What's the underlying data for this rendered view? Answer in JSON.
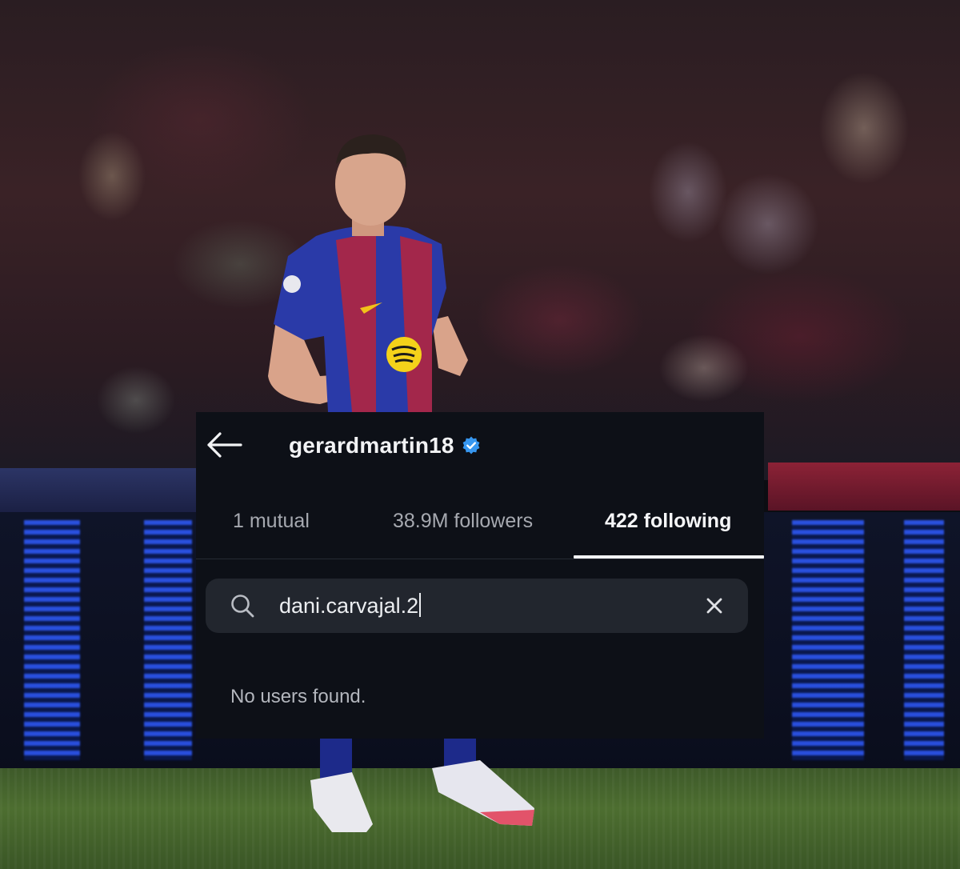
{
  "profile": {
    "username": "gerardmartin18",
    "verified": true
  },
  "tabs": [
    {
      "label": "1 mutual",
      "active": false
    },
    {
      "label": "38.9M followers",
      "active": false
    },
    {
      "label": "422 following",
      "active": true
    }
  ],
  "search": {
    "value": "dani.carvajal.2",
    "focused": true
  },
  "results": {
    "empty_message": "No users found."
  },
  "icons": {
    "back": "arrow-left-icon",
    "verified": "verified-badge-icon",
    "search": "search-icon",
    "clear": "close-icon"
  },
  "colors": {
    "panel_bg": "#0d1017",
    "search_bg": "#22262e",
    "verified": "#3797f0",
    "text_primary": "#f2f3f5",
    "text_secondary": "#a6a9b0"
  }
}
